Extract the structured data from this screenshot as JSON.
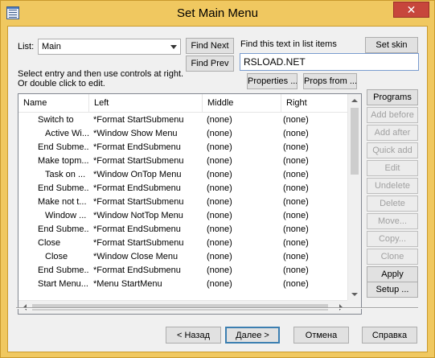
{
  "window": {
    "title": "Set Main Menu",
    "close_glyph": "✕"
  },
  "list_selector": {
    "label": "List:",
    "selected": "Main"
  },
  "find": {
    "next_label": "Find Next",
    "prev_label": "Find Prev",
    "hint": "Find this text in list items",
    "value": "RSLOAD.NET",
    "set_skin_label": "Set skin"
  },
  "instructions": {
    "line1": "Select entry and then use controls at right.",
    "line2": "Or double click to edit."
  },
  "properties_label": "Properties ...",
  "props_from_label": "Props from ...",
  "table": {
    "columns": [
      "Name",
      "Left",
      "Middle",
      "Right"
    ],
    "rows": [
      [
        "Switch to",
        "*Format StartSubmenu",
        "(none)",
        "(none)"
      ],
      [
        "Active Wi...",
        "*Window Show Menu",
        "(none)",
        "(none)"
      ],
      [
        "End Subme...",
        "*Format EndSubmenu",
        "(none)",
        "(none)"
      ],
      [
        "Make topm...",
        "*Format StartSubmenu",
        "(none)",
        "(none)"
      ],
      [
        "Task on ...",
        "*Window OnTop Menu",
        "(none)",
        "(none)"
      ],
      [
        "End Subme...",
        "*Format EndSubmenu",
        "(none)",
        "(none)"
      ],
      [
        "Make not t...",
        "*Format StartSubmenu",
        "(none)",
        "(none)"
      ],
      [
        "Window ...",
        "*Window NotTop Menu",
        "(none)",
        "(none)"
      ],
      [
        "End Subme...",
        "*Format EndSubmenu",
        "(none)",
        "(none)"
      ],
      [
        "Close",
        "*Format StartSubmenu",
        "(none)",
        "(none)"
      ],
      [
        "Close",
        "*Window Close Menu",
        "(none)",
        "(none)"
      ],
      [
        "End Subme...",
        "*Format EndSubmenu",
        "(none)",
        "(none)"
      ],
      [
        "Start Menu...",
        "*Menu StartMenu",
        "(none)",
        "(none)"
      ]
    ],
    "row_indents": [
      1,
      2,
      1,
      1,
      2,
      1,
      1,
      2,
      1,
      1,
      2,
      1,
      1
    ]
  },
  "side_buttons": [
    {
      "label": "Programs",
      "enabled": true
    },
    {
      "label": "Add before",
      "enabled": false
    },
    {
      "label": "Add after",
      "enabled": false
    },
    {
      "label": "Quick add",
      "enabled": false
    },
    {
      "label": "Edit",
      "enabled": false
    },
    {
      "label": "Undelete",
      "enabled": false
    },
    {
      "label": "Delete",
      "enabled": false
    },
    {
      "label": "Move...",
      "enabled": false
    },
    {
      "label": "Copy...",
      "enabled": false
    },
    {
      "label": "Clone",
      "enabled": false
    },
    {
      "label": "Apply",
      "enabled": true
    },
    {
      "label": "Setup ...",
      "enabled": true
    }
  ],
  "footer": {
    "back_label": "< Назад",
    "next_label": "Далее >",
    "cancel_label": "Отмена",
    "help_label": "Справка"
  }
}
